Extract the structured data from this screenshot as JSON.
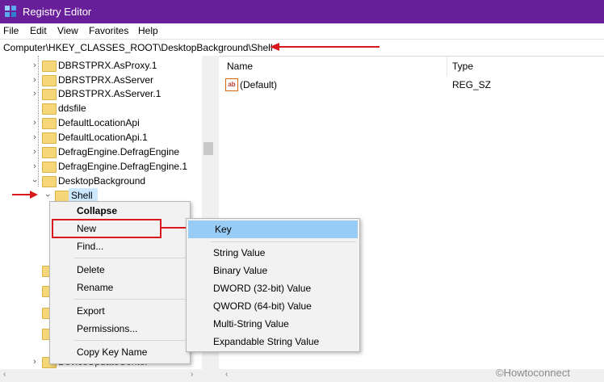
{
  "window": {
    "title": "Registry Editor"
  },
  "menubar": {
    "items": [
      "File",
      "Edit",
      "View",
      "Favorites",
      "Help"
    ]
  },
  "address": {
    "path": "Computer\\HKEY_CLASSES_ROOT\\DesktopBackground\\Shell"
  },
  "tree": {
    "items": [
      {
        "label": "DBRSTPRX.AsProxy.1",
        "expander": "collapsed"
      },
      {
        "label": "DBRSTPRX.AsServer",
        "expander": "collapsed"
      },
      {
        "label": "DBRSTPRX.AsServer.1",
        "expander": "collapsed"
      },
      {
        "label": "ddsfile",
        "expander": "none"
      },
      {
        "label": "DefaultLocationApi",
        "expander": "collapsed"
      },
      {
        "label": "DefaultLocationApi.1",
        "expander": "collapsed"
      },
      {
        "label": "DefragEngine.DefragEngine",
        "expander": "collapsed"
      },
      {
        "label": "DefragEngine.DefragEngine.1",
        "expander": "collapsed"
      },
      {
        "label": "DesktopBackground",
        "expander": "expanded"
      },
      {
        "label": "Shell",
        "expander": "expanded",
        "selected": true
      }
    ],
    "partial_bottom_label": "DeviceUpdateCenter"
  },
  "values_pane": {
    "columns": [
      "Name",
      "Type"
    ],
    "rows": [
      {
        "name": "(Default)",
        "type": "REG_SZ",
        "icon": "string-value-icon"
      }
    ]
  },
  "context_menu": {
    "items": [
      "Collapse",
      "New",
      "Find...",
      "Delete",
      "Rename",
      "Export",
      "Permissions...",
      "Copy Key Name"
    ],
    "submenu_arrow": "›"
  },
  "new_submenu": {
    "items": [
      "Key",
      "String Value",
      "Binary Value",
      "DWORD (32-bit) Value",
      "QWORD (64-bit) Value",
      "Multi-String Value",
      "Expandable String Value"
    ]
  },
  "watermark": "©Howtoconnect",
  "colors": {
    "titlebar": "#6a1f9a",
    "selection": "#cce8ff",
    "highlight": "#99ccf5",
    "annotation": "#d9181e"
  }
}
